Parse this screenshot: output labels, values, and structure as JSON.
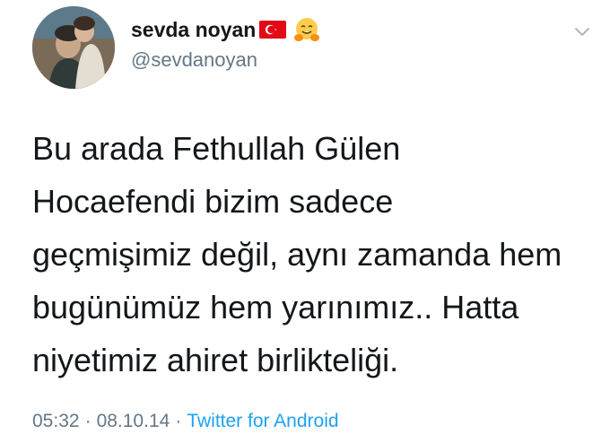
{
  "user": {
    "display_name": "sevda noyan",
    "handle": "@sevdanoyan",
    "badges": [
      "turkey-flag-icon",
      "hugging-face-icon"
    ]
  },
  "tweet": {
    "lines": [
      "Bu arada Fethullah Gülen",
      "Hocaefendi bizim sadece",
      "geçmişimiz değil, aynı zamanda hem",
      "bugünümüz hem yarınımız.. Hatta",
      "niyetimiz ahiret birlikteliği."
    ]
  },
  "meta": {
    "time": "05:32",
    "separator": "·",
    "date": "08.10.14",
    "source": "Twitter for Android"
  },
  "colors": {
    "text": "#14171a",
    "secondary": "#657786",
    "link": "#1da1f2",
    "flag_red": "#e30a17"
  }
}
